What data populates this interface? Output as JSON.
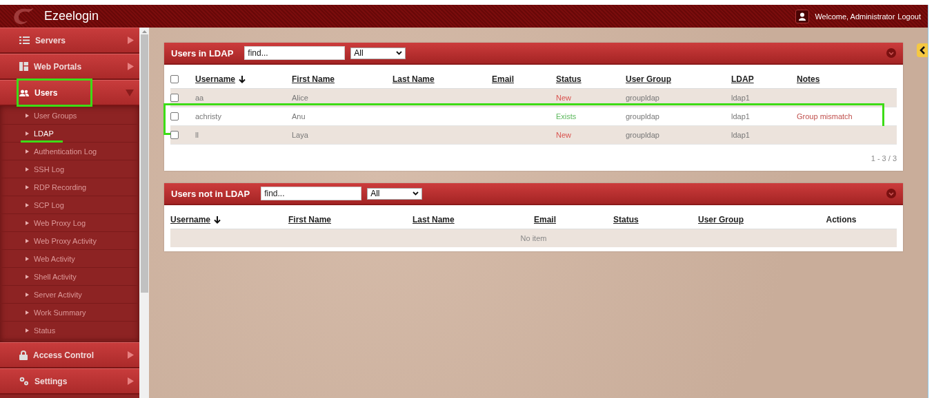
{
  "topbar": {
    "title": "Ezeelogin",
    "welcome": "Welcome, Administrator",
    "logout": "Logout"
  },
  "sidebar": {
    "items": [
      {
        "label": "Servers",
        "expanded": false,
        "selected": false,
        "highlighted": false
      },
      {
        "label": "Web Portals",
        "expanded": false,
        "selected": false,
        "highlighted": false
      },
      {
        "label": "Users",
        "expanded": true,
        "selected": true,
        "highlighted": true,
        "children": [
          {
            "label": "User Groups",
            "selected": false,
            "underlined": false
          },
          {
            "label": "LDAP",
            "selected": true,
            "underlined": true
          },
          {
            "label": "Authentication Log",
            "selected": false,
            "underlined": false
          },
          {
            "label": "SSH Log",
            "selected": false,
            "underlined": false
          },
          {
            "label": "RDP Recording",
            "selected": false,
            "underlined": false
          },
          {
            "label": "SCP Log",
            "selected": false,
            "underlined": false
          },
          {
            "label": "Web Proxy Log",
            "selected": false,
            "underlined": false
          },
          {
            "label": "Web Proxy Activity",
            "selected": false,
            "underlined": false
          },
          {
            "label": "Web Activity",
            "selected": false,
            "underlined": false
          },
          {
            "label": "Shell Activity",
            "selected": false,
            "underlined": false
          },
          {
            "label": "Server Activity",
            "selected": false,
            "underlined": false
          },
          {
            "label": "Work Summary",
            "selected": false,
            "underlined": false
          },
          {
            "label": "Status",
            "selected": false,
            "underlined": false
          }
        ]
      },
      {
        "label": "Access Control",
        "expanded": false,
        "selected": false,
        "highlighted": false
      },
      {
        "label": "Settings",
        "expanded": false,
        "selected": false,
        "highlighted": false
      }
    ]
  },
  "panels": [
    {
      "title": "Users in LDAP",
      "search": {
        "placeholder": "find..."
      },
      "filter": "All",
      "select_all_checked": false,
      "columns": [
        {
          "label": "Username",
          "sortable": true,
          "sorted": true
        },
        {
          "label": "First Name",
          "sortable": true,
          "sorted": false
        },
        {
          "label": "Last Name",
          "sortable": true,
          "sorted": false
        },
        {
          "label": "Email",
          "sortable": true,
          "sorted": false
        },
        {
          "label": "Status",
          "sortable": true,
          "sorted": false
        },
        {
          "label": "User Group",
          "sortable": true,
          "sorted": false
        },
        {
          "label": "LDAP",
          "sortable": true,
          "sorted": false
        },
        {
          "label": "Notes",
          "sortable": true,
          "sorted": false
        }
      ],
      "rows": [
        {
          "checked": false,
          "highlighted": false,
          "cells": [
            "aa",
            "Alice",
            "",
            "",
            "New",
            "groupldap",
            "ldap1",
            ""
          ],
          "kind": "new"
        },
        {
          "checked": false,
          "highlighted": true,
          "cells": [
            "achristy",
            "Anu",
            "",
            "",
            "Exists",
            "groupldap",
            "ldap1",
            "Group mismatch"
          ],
          "kind": "exists"
        },
        {
          "checked": false,
          "highlighted": false,
          "cells": [
            "ll",
            "Laya",
            "",
            "",
            "New",
            "groupldap",
            "ldap1",
            ""
          ],
          "kind": "new"
        }
      ],
      "pagination": "1 - 3 / 3"
    },
    {
      "title": "Users not in LDAP",
      "search": {
        "placeholder": "find..."
      },
      "filter": "All",
      "columns": [
        {
          "label": "Username",
          "sortable": true,
          "sorted": true
        },
        {
          "label": "First Name",
          "sortable": true,
          "sorted": false
        },
        {
          "label": "Last Name",
          "sortable": true,
          "sorted": false
        },
        {
          "label": "Email",
          "sortable": true,
          "sorted": false
        },
        {
          "label": "Status",
          "sortable": true,
          "sorted": false
        },
        {
          "label": "User Group",
          "sortable": true,
          "sorted": false
        },
        {
          "label": "Actions",
          "sortable": false,
          "sorted": false
        }
      ],
      "empty_text": "No item"
    }
  ]
}
